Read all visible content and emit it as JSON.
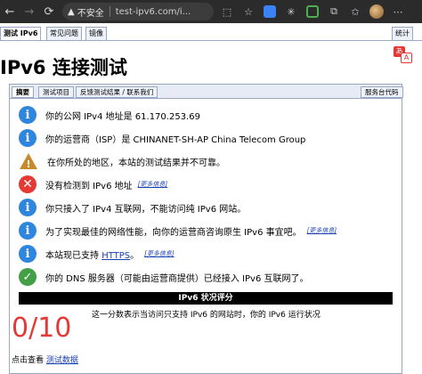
{
  "browser": {
    "back_icon": "back-arrow-icon",
    "forward_icon": "forward-arrow-icon",
    "reload_icon": "reload-icon",
    "security_label": "不安全",
    "url": "test-ipv6.com/i..."
  },
  "menu": {
    "tabs": [
      "测试 IPv6",
      "常见问题",
      "镜像"
    ],
    "stats": "统计"
  },
  "page_title": "IPv6 连接测试",
  "subtabs": [
    "摘要",
    "测试项目",
    "反馈测试结果 / 联系我们"
  ],
  "subtab_right": "服务台代码",
  "rows": [
    {
      "icon": "info",
      "text": "你的公网 IPv4 地址是 61.170.253.69"
    },
    {
      "icon": "info",
      "text": "你的运营商（ISP）是 CHINANET-SH-AP China Telecom Group"
    },
    {
      "icon": "warning",
      "text": "在你所处的地区，本站的测试结果并不可靠。"
    },
    {
      "icon": "error",
      "text": "没有检测到 IPv6 地址",
      "more": "[更多信息]"
    },
    {
      "icon": "info",
      "text": "你只接入了 IPv4 互联网，不能访问纯 IPv6 网站。"
    },
    {
      "icon": "info",
      "text": "为了实现最佳的网络性能，向你的运营商咨询原生 IPv6 事宜吧。",
      "more": "[更多信息]"
    },
    {
      "icon": "info",
      "text_before": "本站现已支持 ",
      "link": "HTTPS",
      "text_after": "。",
      "more": "[更多信息]"
    },
    {
      "icon": "ok",
      "text": "你的 DNS 服务器（可能由运营商提供）已经接入 IPv6 互联网了。"
    }
  ],
  "score": {
    "header": "IPv6 状况评分",
    "value": "0/10",
    "description": "这一分数表示当访问只支持 IPv6 的网站时，你的 IPv6 运行状况"
  },
  "footer": {
    "prefix": "点击查看 ",
    "link": "测试数据"
  }
}
